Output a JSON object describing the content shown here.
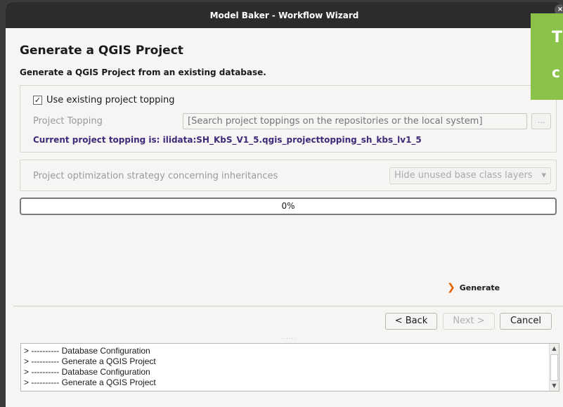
{
  "window": {
    "title": "Model Baker - Workflow Wizard",
    "close_glyph": "×"
  },
  "banner": {
    "line1": "T",
    "line2": "c",
    "color": "#8bc34a"
  },
  "page": {
    "title": "Generate a QGIS Project",
    "subtitle": "Generate a QGIS Project from an existing database."
  },
  "topping": {
    "use_existing_label": "Use existing project topping",
    "use_existing_checked": true,
    "check_glyph": "✓",
    "field_label": "Project Topping",
    "search_placeholder": "[Search project toppings on the repositories or the local system]",
    "browse_label": "...",
    "current": "Current project topping is: ilidata:SH_KbS_V1_5.qgis_projecttopping_sh_kbs_lv1_5"
  },
  "optimization": {
    "label": "Project optimization strategy concerning inheritances",
    "selected": "Hide unused base class layers",
    "arrow": "▾"
  },
  "progress": {
    "value": 0,
    "text": "0%"
  },
  "generate": {
    "label": "Generate",
    "icon": "chevron-right-icon",
    "glyph": "❯",
    "icon_color": "#e66100"
  },
  "nav": {
    "back": "< Back",
    "next": "Next >",
    "cancel": "Cancel"
  },
  "splitter_glyph": "......",
  "log": {
    "lines": [
      "> ---------- Database Configuration",
      "> ---------- Generate a QGIS Project",
      "> ---------- Database Configuration",
      "> ---------- Generate a QGIS Project"
    ]
  },
  "scroll": {
    "up": "▲",
    "down": "▼"
  }
}
